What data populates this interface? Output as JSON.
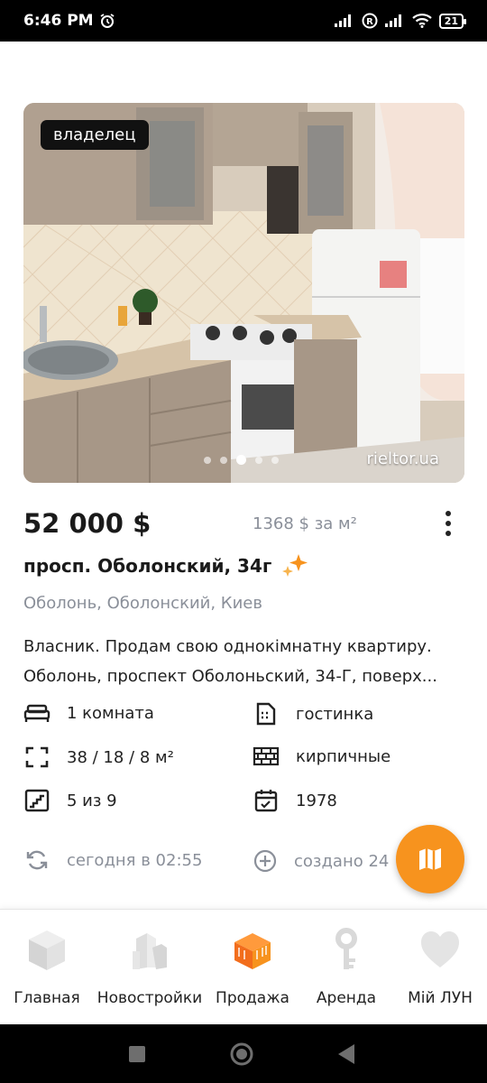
{
  "status_bar": {
    "time": "6:46 PM",
    "battery": "21"
  },
  "listing": {
    "owner_badge": "владелец",
    "watermark": "rieltor.ua",
    "photo_count_dots": 5,
    "active_photo_index": 3,
    "price": "52 000 $",
    "price_per_m2": "1368 $ за м²",
    "address": "просп. Оболонский, 34г",
    "district": "Оболонь, Оболонский, Киев",
    "description": "Власник. Продам свою однокімнатну квартиру. Оболонь, проспект Оболоньский, 34-Г, поверх...",
    "features": {
      "rooms": "1 комната",
      "type": "гостинка",
      "area": "38 / 18 / 8 м²",
      "walls": "кирпичные",
      "floor": "5 из 9",
      "year": "1978"
    },
    "updated": "сегодня в 02:55",
    "created": "создано 24"
  },
  "bottom_nav": {
    "items": [
      {
        "label": "Главная",
        "icon": "cube-icon"
      },
      {
        "label": "Новостройки",
        "icon": "buildings-icon"
      },
      {
        "label": "Продажа",
        "icon": "sale-building-icon"
      },
      {
        "label": "Аренда",
        "icon": "key-icon"
      },
      {
        "label": "Мій ЛУН",
        "icon": "heart-icon"
      }
    ],
    "active_index": 2
  },
  "colors": {
    "accent": "#f7931e",
    "muted_text": "#8a8f99"
  }
}
